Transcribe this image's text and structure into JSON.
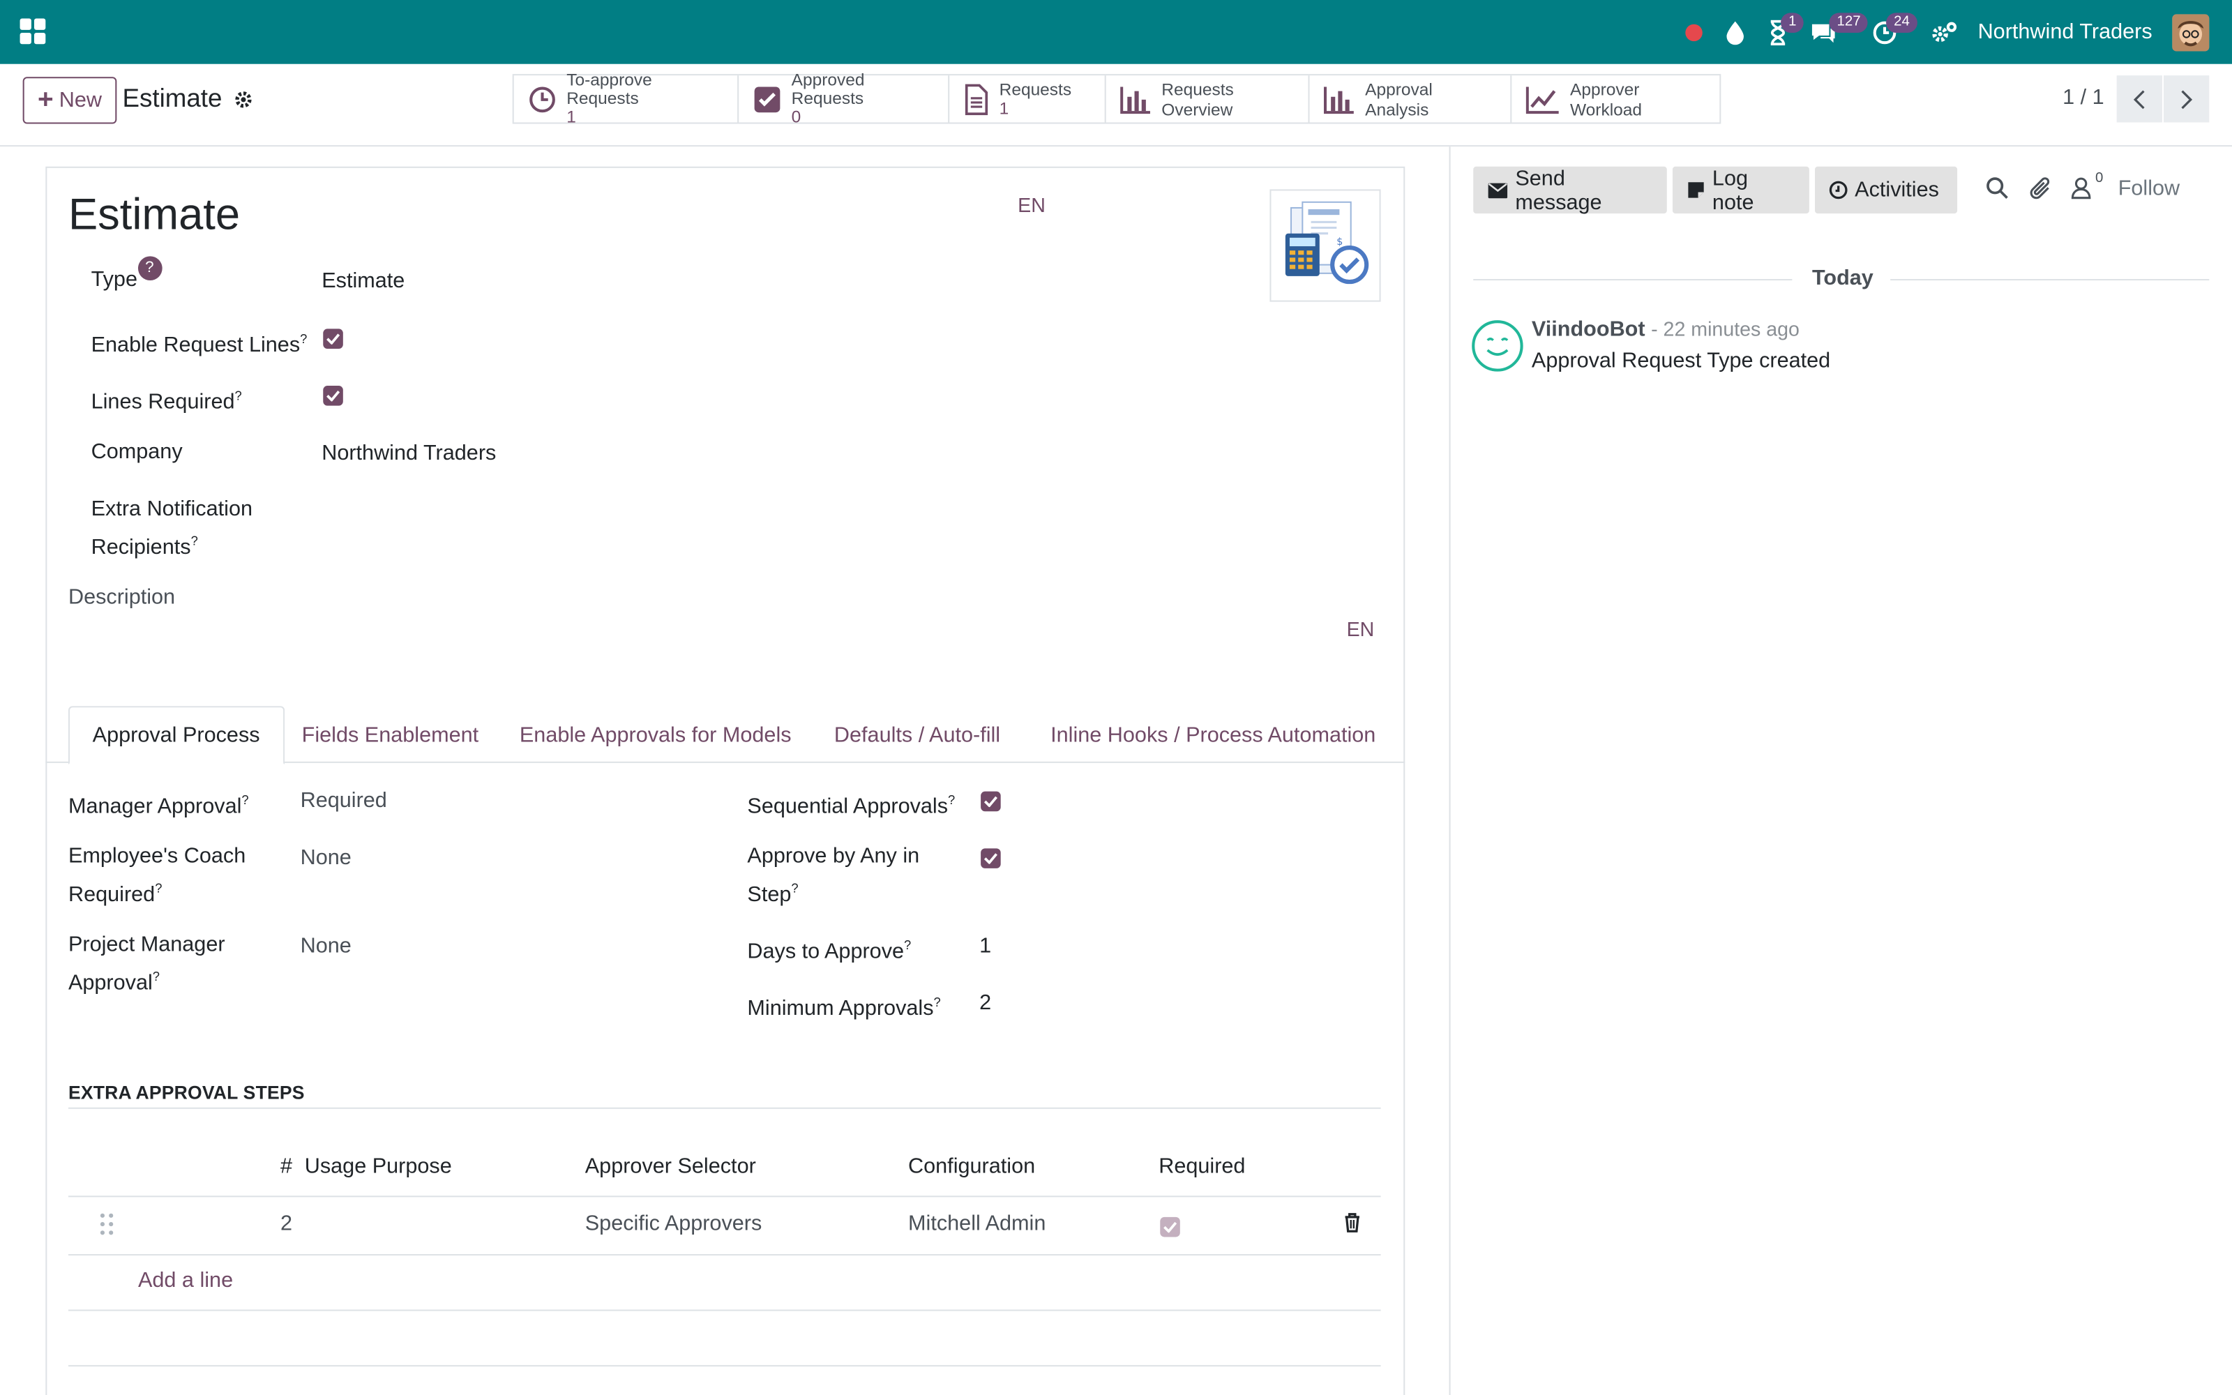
{
  "navbar": {
    "company": "Northwind Traders",
    "badges": {
      "activity": "1",
      "messages": "127",
      "clock": "24"
    }
  },
  "control": {
    "new_label": "New",
    "breadcrumb": "Estimate",
    "smart_buttons": [
      {
        "label": "To-approve Requests",
        "value": "1",
        "icon": "clock-icon"
      },
      {
        "label": "Approved Requests",
        "value": "0",
        "icon": "check-square-icon"
      },
      {
        "label": "Requests",
        "value": "1",
        "icon": "document-icon"
      },
      {
        "label": "Requests Overview",
        "icon": "bar-chart-icon"
      },
      {
        "label": "Approval Analysis",
        "icon": "bar-chart-icon"
      },
      {
        "label": "Approver Workload",
        "icon": "line-chart-icon"
      }
    ],
    "pager": "1 / 1"
  },
  "form": {
    "title": "Estimate",
    "lang_title": "EN",
    "lang_description": "EN",
    "fields": {
      "type_label": "Type",
      "type_value": "Estimate",
      "enable_lines_label": "Enable Request Lines",
      "lines_required_label": "Lines Required",
      "company_label": "Company",
      "company_value": "Northwind Traders",
      "extra_recipients_label_1": "Extra Notification",
      "extra_recipients_label_2": "Recipients",
      "description_label": "Description"
    },
    "tabs": [
      "Approval Process",
      "Fields Enablement",
      "Enable Approvals for Models",
      "Defaults / Auto-fill",
      "Inline Hooks / Process Automation"
    ],
    "approval": {
      "manager_label": "Manager Approval",
      "manager_value": "Required",
      "coach_label_1": "Employee's Coach",
      "coach_label_2": "Required",
      "coach_value": "None",
      "pm_label_1": "Project Manager",
      "pm_label_2": "Approval",
      "pm_value": "None",
      "sequential_label": "Sequential Approvals",
      "any_label_1": "Approve by Any in",
      "any_label_2": "Step",
      "days_label": "Days to Approve",
      "days_value": "1",
      "min_label": "Minimum Approvals",
      "min_value": "2"
    },
    "steps": {
      "title": "EXTRA APPROVAL STEPS",
      "columns": [
        "#",
        "Usage Purpose",
        "Approver Selector",
        "Configuration",
        "Required"
      ],
      "rows": [
        {
          "num": "2",
          "purpose": "",
          "selector": "Specific Approvers",
          "config": "Mitchell Admin",
          "required": true
        }
      ],
      "add_line": "Add a line"
    }
  },
  "chatter": {
    "send_message": "Send message",
    "log_note": "Log note",
    "activities": "Activities",
    "followers_count": "0",
    "follow": "Follow",
    "today": "Today",
    "author": "ViindooBot",
    "time": "- 22 minutes ago",
    "body": "Approval Request Type created"
  }
}
